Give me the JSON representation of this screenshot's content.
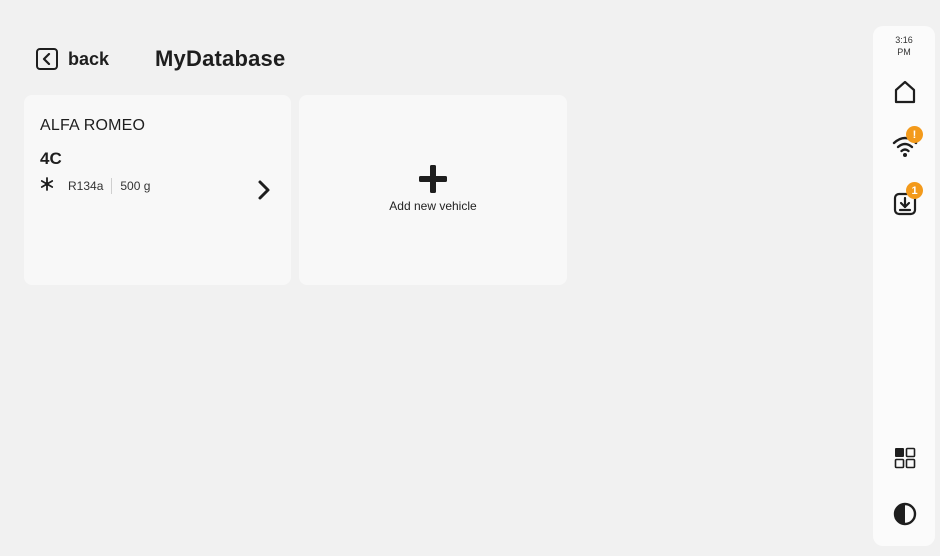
{
  "header": {
    "back_label": "back",
    "title": "MyDatabase"
  },
  "vehicles": [
    {
      "make": "ALFA ROMEO",
      "model": "4C",
      "refrigerant": "R134a",
      "amount": "500 g"
    }
  ],
  "add_vehicle": {
    "label": "Add new vehicle"
  },
  "status": {
    "time": "3:16",
    "ampm": "PM",
    "wifi_badge": "!",
    "download_badge": "1"
  },
  "colors": {
    "background": "#f1f1f1",
    "card": "#f8f8f8",
    "badge": "#f39a1b",
    "text": "#1e1e1e"
  },
  "icons": {
    "back": "chevron-left-box-icon",
    "refrigerant": "snowflake-icon",
    "open": "chevron-right-icon",
    "add": "plus-icon",
    "home": "home-icon",
    "wifi": "wifi-icon",
    "download": "download-icon",
    "apps": "grid-icon",
    "theme": "contrast-icon"
  }
}
